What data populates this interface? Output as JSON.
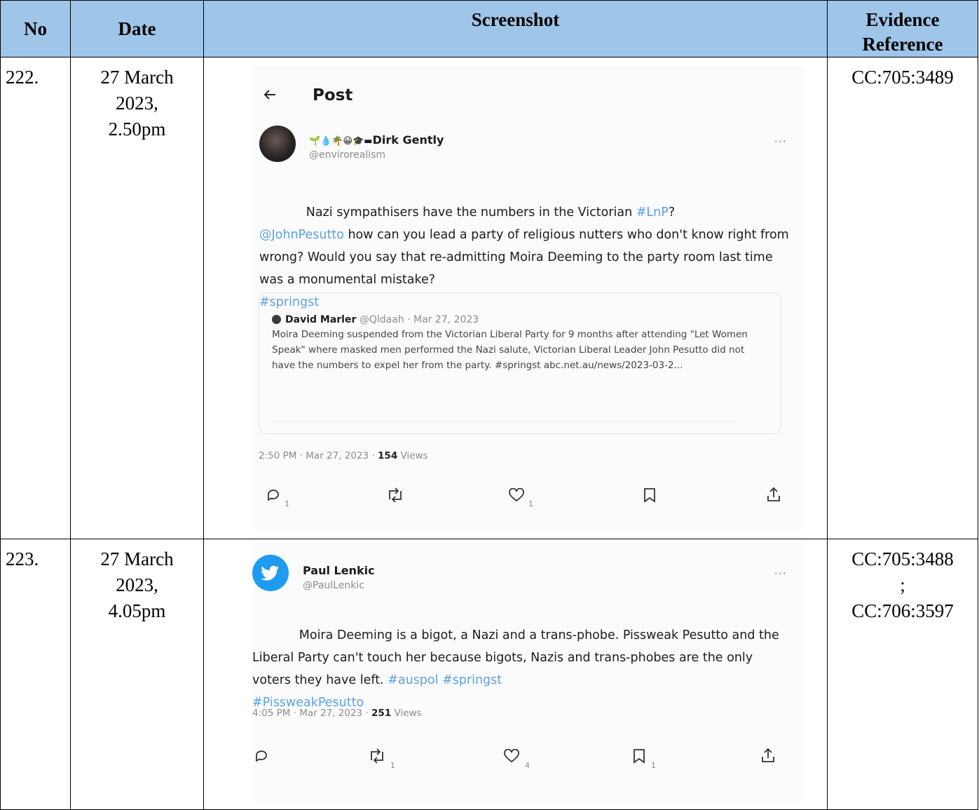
{
  "table": {
    "headers": {
      "no": "No",
      "date": "Date",
      "screenshot": "Screenshot",
      "evidence": "Evidence Reference"
    },
    "rows": [
      {
        "no": "222.",
        "date": [
          "27 March",
          "2023,",
          "2.50pm"
        ],
        "evidence": [
          "CC:705:3489"
        ],
        "post": {
          "header_title": "Post",
          "emoji": "🌱💧🌴😀🎓▬",
          "display_name": "Dirk Gently",
          "handle": "@envirorealism",
          "text_segments": [
            "Nazi sympathisers have the numbers in the Victorian ",
            "#LnP",
            "?\n",
            "@JohnPesutto",
            " how can you lead a party of religious nutters who don't know right from wrong? Would you say that re-admitting Moira Deeming to the party room last time was a monumental mistake?\n",
            "#springst"
          ],
          "quote": {
            "name": "David Marler",
            "handle": "@Qldaah",
            "date": "· Mar 27, 2023",
            "text": "Moira Deeming suspended from the Victorian Liberal Party for 9 months after attending \"Let Women Speak\" where masked men performed the Nazi salute, Victorian Liberal Leader John Pesutto did not have the numbers to expel her from the party. #springst abc.net.au/news/2023-03-2..."
          },
          "timestamp": "2:50 PM · Mar 27, 2023 · ",
          "views_count": "154",
          "views_label": " Views",
          "actions": {
            "reply": "1",
            "retweet": "",
            "like": "1",
            "bookmark": ""
          }
        }
      },
      {
        "no": "223.",
        "date": [
          "27 March",
          "2023,",
          "4.05pm"
        ],
        "evidence": [
          "CC:705:3488",
          ";",
          "CC:706:3597"
        ],
        "post": {
          "display_name": "Paul Lenkic",
          "handle": "@PaulLenkic",
          "text_segments": [
            "Moira Deeming is a bigot, a Nazi and a trans-phobe. Pissweak Pesutto and the Liberal Party can't touch her because bigots, Nazis and trans-phobes are the only voters they have left. ",
            "#auspol #springst\n#PissweakPesutto"
          ],
          "timestamp": "4:05 PM · Mar 27, 2023 · ",
          "views_count": "251",
          "views_label": " Views",
          "actions": {
            "reply": "",
            "retweet": "1",
            "like": "4",
            "bookmark": "1"
          }
        }
      }
    ]
  },
  "colors": {
    "header_bg": "#9fc5e8",
    "link": "#5aa2e3",
    "twitter_blue": "#1d9bf0"
  },
  "icons": [
    "back-arrow-icon",
    "more-icon",
    "reply-icon",
    "retweet-icon",
    "like-icon",
    "bookmark-icon",
    "share-icon",
    "twitter-bird-icon"
  ]
}
